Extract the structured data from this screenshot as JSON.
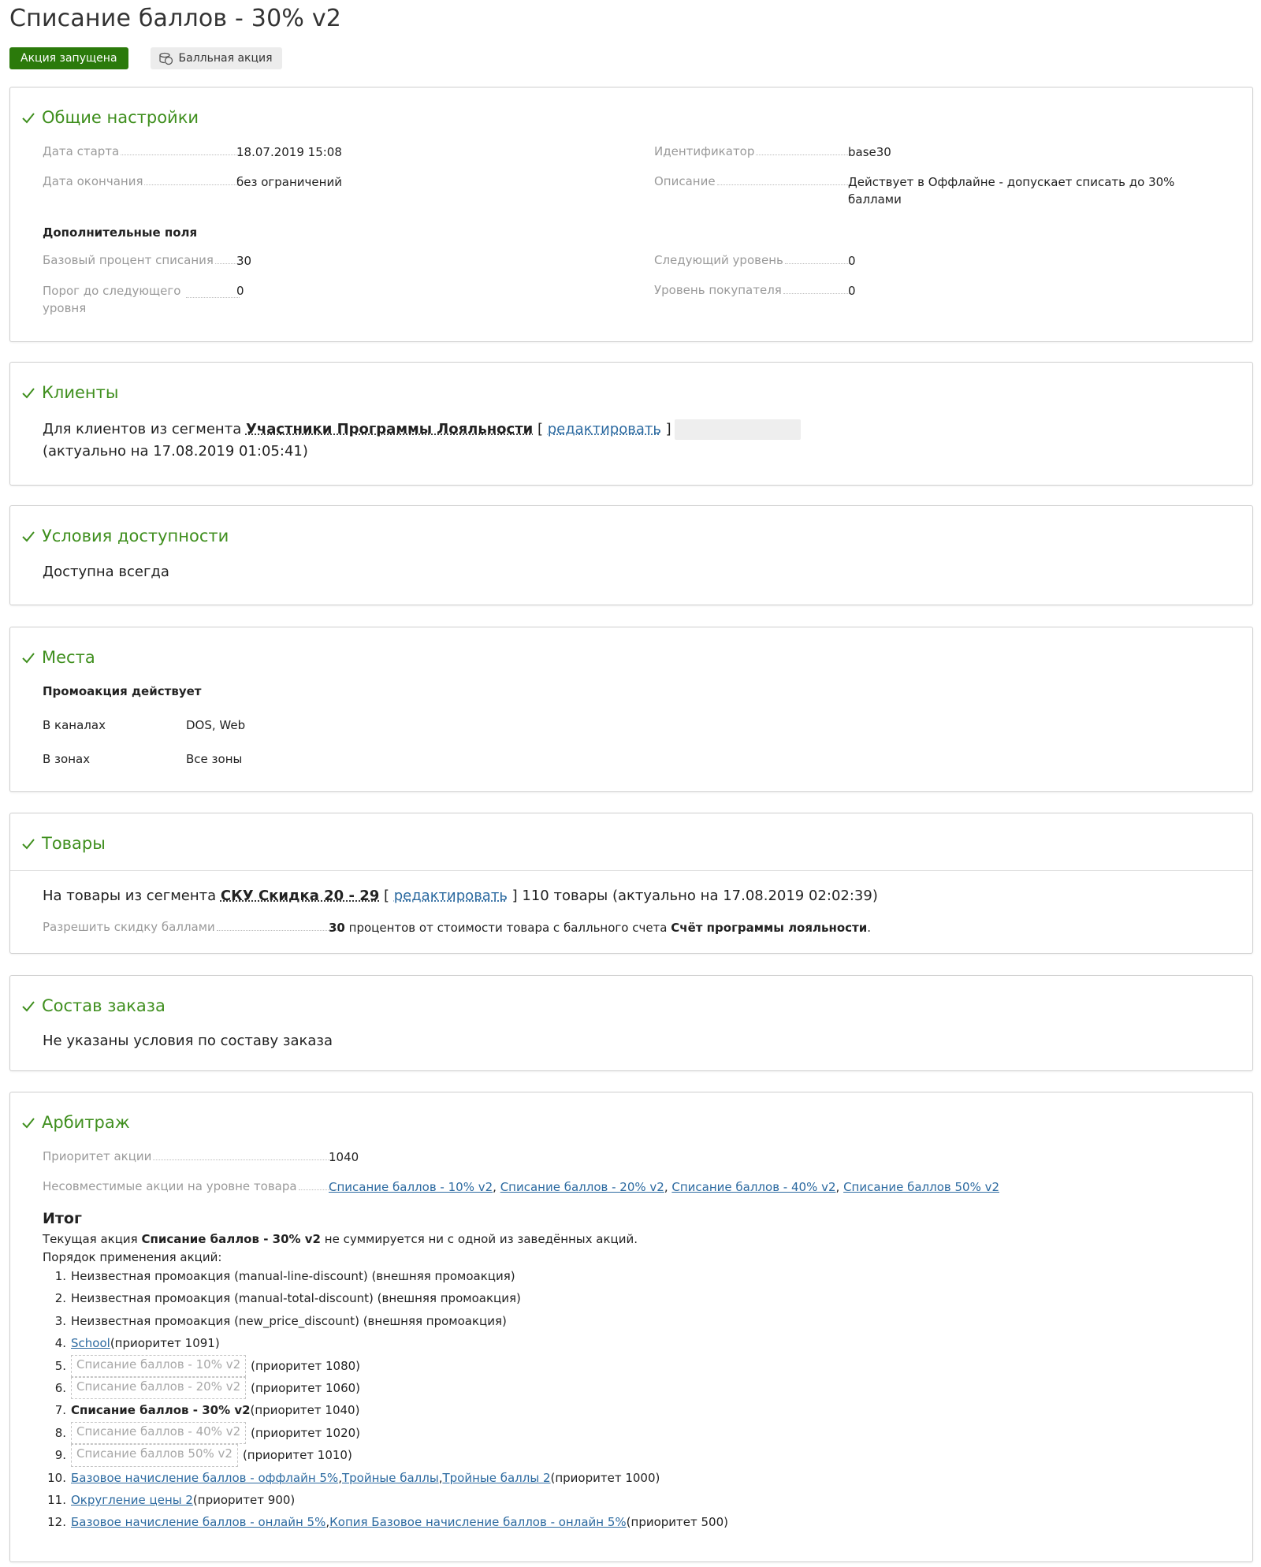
{
  "header": {
    "title": "Списание баллов - 30% v2",
    "status_badge": "Акция запущена",
    "type_badge": "Балльная акция",
    "type_badge_icon": "coins-icon"
  },
  "general": {
    "title": "Общие настройки",
    "start_label": "Дата старта",
    "start_value": "18.07.2019 15:08",
    "end_label": "Дата окончания",
    "end_value": "без ограничений",
    "id_label": "Идентификатор",
    "id_value": "base30",
    "desc_label": "Описание",
    "desc_value": "Действует в Оффлайне - допускает списать до 30% баллами",
    "extra_title": "Дополнительные поля",
    "base_pct_label": "Базовый процент списания",
    "base_pct_value": "30",
    "threshold_label": "Порог до следующего уровня",
    "threshold_value": "0",
    "next_level_label": "Следующий уровень",
    "next_level_value": "0",
    "buyer_level_label": "Уровень покупателя",
    "buyer_level_value": "0"
  },
  "clients": {
    "title": "Клиенты",
    "prefix": "Для клиентов из сегмента ",
    "segment": "Участники Программы Лояльности",
    "bracket_open": " [ ",
    "edit_link": "редактировать",
    "bracket_close": " ]",
    "suffix": "(актуально на 17.08.2019 01:05:41)"
  },
  "availability": {
    "title": "Условия доступности",
    "text": "Доступна всегда"
  },
  "places": {
    "title": "Места",
    "subtitle": "Промоакция действует",
    "channels_label": "В каналах",
    "channels_value": "DOS, Web",
    "zones_label": "В зонах",
    "zones_value": "Все зоны"
  },
  "goods": {
    "title": "Товары",
    "prefix": "На товары из сегмента ",
    "segment": "СКУ Скидка 20 - 29",
    "bracket_open": " [ ",
    "edit_link": "редактировать",
    "suffix": " ] 110 товары (актуально на 17.08.2019 02:02:39)",
    "allow_label": "Разрешить скидку баллами",
    "allow_number": "30",
    "allow_text": " процентов от стоимости товара с балльного счета ",
    "allow_account": "Счёт программы лояльности",
    "allow_end": "."
  },
  "order": {
    "title": "Состав заказа",
    "text": "Не указаны условия по составу заказа"
  },
  "arbitrage": {
    "title": "Арбитраж",
    "priority_label": "Приоритет акции",
    "priority_value": "1040",
    "incompat_label": "Несовместимые акции на уровне товара",
    "incompat_links": [
      "Списание баллов - 10% v2",
      "Списание баллов - 20% v2",
      "Списание баллов - 40% v2",
      "Списание баллов 50% v2"
    ],
    "sep": ", ",
    "itog_title": "Итог",
    "itog_prefix": "Текущая акция ",
    "itog_bold": "Списание баллов - 30% v2",
    "itog_suffix": " не суммируется ни с одной из заведённых акций.",
    "order_title": "Порядок применения акций:",
    "items": {
      "i1_num": "1.",
      "i1_text": "Неизвестная промоакция (manual-line-discount) (внешняя промоакция)",
      "i2_num": "2.",
      "i2_text": "Неизвестная промоакция (manual-total-discount) (внешняя промоакция)",
      "i3_num": "3.",
      "i3_text": "Неизвестная промоакция (new_price_discount) (внешняя промоакция)",
      "i4_num": "4.",
      "i4_link": "School",
      "i4_prio": " (приоритет 1091)",
      "i5_num": "5.",
      "i5_name": "Списание баллов - 10% v2",
      "i5_prio": "(приоритет 1080)",
      "i6_num": "6.",
      "i6_name": "Списание баллов - 20% v2",
      "i6_prio": "(приоритет 1060)",
      "i7_num": "7.",
      "i7_name": "Списание баллов - 30% v2",
      "i7_prio": " (приоритет 1040)",
      "i8_num": "8.",
      "i8_name": "Списание баллов - 40% v2",
      "i8_prio": "(приоритет 1020)",
      "i9_num": "9.",
      "i9_name": "Списание баллов 50% v2",
      "i9_prio": "(приоритет 1010)",
      "i10_num": "10.",
      "i10_link1": "Базовое начисление баллов - оффлайн 5%",
      "i10_link2": "Тройные баллы",
      "i10_link3": "Тройные баллы 2",
      "i10_prio": " (приоритет 1000)",
      "i11_num": "11.",
      "i11_link": "Округление цены 2",
      "i11_prio": " (приоритет 900)",
      "i12_num": "12.",
      "i12_link1": "Базовое начисление баллов - онлайн 5%",
      "i12_link2": "Копия Базовое начисление баллов - онлайн 5%",
      "i12_prio": " (приоритет 500)"
    }
  },
  "colors": {
    "accent_green": "#3f8f1e",
    "badge_green": "#2b7a0b",
    "link_blue": "#2c6aa0"
  }
}
